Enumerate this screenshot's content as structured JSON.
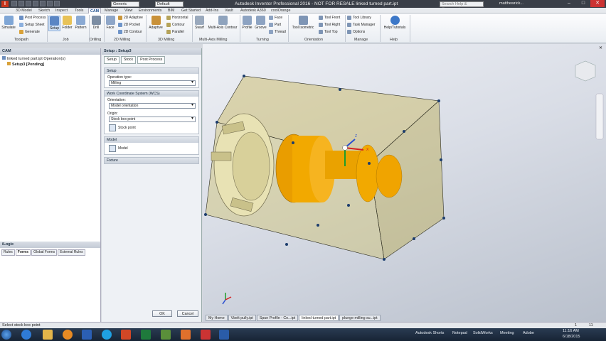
{
  "window": {
    "title": "Autodesk Inventor Professional 2016 - NOT FOR RESALE   linked turned part.ipt",
    "app_letter": "I",
    "style_combo": "Generic",
    "material_combo": "Default",
    "search_placeholder": "Search Help & Commands...",
    "user": "matthewrick...",
    "min": "–",
    "max": "□",
    "close": "✕"
  },
  "tabs": [
    "3D Model",
    "Sketch",
    "Inspect",
    "Tools",
    "CAM",
    "Manage",
    "View",
    "Environments",
    "BIM",
    "Get Started",
    "Add-Ins",
    "Vault",
    "Autodesk A360",
    "coolOrange"
  ],
  "active_tab": "CAM",
  "ribbon": {
    "toolpath": {
      "label": "Toolpath",
      "simulate": "Simulate",
      "post_process": "Post Process",
      "setup_sheet": "Setup Sheet",
      "generate": "Generate"
    },
    "job": {
      "label": "Job",
      "setup": "Setup",
      "folder": "Folder",
      "pattern": "Pattern"
    },
    "drilling": {
      "label": "Drilling",
      "drill": "Drill"
    },
    "milling2d": {
      "label": "2D Milling",
      "face": "Face",
      "adaptive2d": "2D Adaptive",
      "pocket2d": "2D Pocket",
      "contour2d": "2D Contour"
    },
    "milling3d": {
      "label": "3D Milling",
      "adaptive": "Adaptive",
      "horizontal": "Horizontal",
      "contour": "Contour",
      "parallel": "Parallel"
    },
    "multiaxis": {
      "label": "Multi-Axis Milling",
      "swarf": "Swarf",
      "multi_axis_contour": "Multi-Axis Contour"
    },
    "turning": {
      "label": "Turning",
      "profile": "Profile",
      "groove": "Groove",
      "face": "Face",
      "part": "Part",
      "thread": "Thread"
    },
    "orientation": {
      "label": "Orientation",
      "tool_isometric": "Tool Isometric",
      "tool_front": "Tool Front",
      "tool_right": "Tool Right",
      "tool_top": "Tool Top"
    },
    "manage": {
      "label": "Manage",
      "tool_library": "Tool Library",
      "task_manager": "Task Manager",
      "options": "Options"
    },
    "help": {
      "label": "Help",
      "help_tutorials": "Help/Tutorials"
    }
  },
  "cam_browser": {
    "title": "CAM",
    "file": "linked turned part.ipt Operation(s)",
    "setup": "Setup3 [Pending]"
  },
  "ilogic": {
    "title": "iLogic",
    "tabs": [
      "Rules",
      "Forms",
      "Global Forms",
      "External Rules"
    ],
    "active": "Forms"
  },
  "setup_panel": {
    "title": "Setup : Setup3",
    "tabs": [
      "Setup",
      "Stock",
      "Post Process"
    ],
    "setup_section": "Setup",
    "operation_type_label": "Operation type:",
    "operation_type": "Milling",
    "wcs_section": "Work Coordinate System (WCS)",
    "orientation_label": "Orientation:",
    "orientation": "Model orientation",
    "origin_label": "Origin:",
    "origin": "Stock box point",
    "stock_point": "Stock point",
    "model_section": "Model",
    "model": "Model",
    "fixture_section": "Fixture",
    "ok": "OK",
    "cancel": "Cancel"
  },
  "viewport": {
    "axis_z": "Z",
    "axis_x": "X",
    "doc_tabs": [
      "My Home",
      "Vbelt pully.ipt",
      "Spun Profile - Co...ipt",
      "linked turned part.ipt",
      "plunge milling su...ipt"
    ],
    "active_doc": "linked turned part.ipt",
    "page": "1",
    "count": "11"
  },
  "status_text": "Select stock box point",
  "taskbar": {
    "items": [
      "Autodesk Shorts",
      "Notepad",
      "SolidWorks",
      "Meeting",
      "Adobe"
    ],
    "time": "11:16 AM",
    "date": "6/18/2015"
  },
  "colors": {
    "stock": "#c8b65a",
    "part": "#f0a800",
    "accent": "#1a4a8a"
  }
}
